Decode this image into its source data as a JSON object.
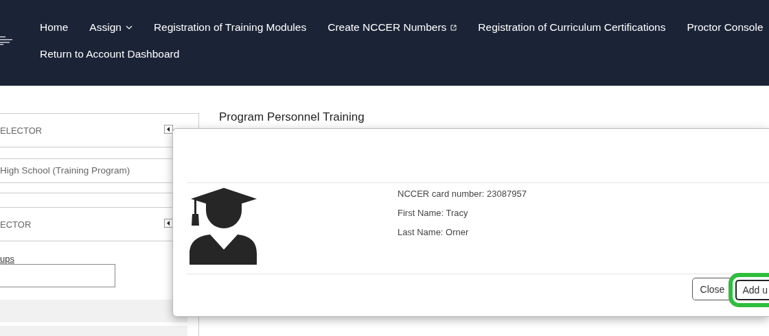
{
  "header": {
    "nav_rows": [
      [
        {
          "label": "Home",
          "kind": "link"
        },
        {
          "label": "Assign",
          "kind": "dropdown"
        },
        {
          "label": "Registration of Training Modules",
          "kind": "link"
        },
        {
          "label": "Create NCCER Numbers",
          "kind": "external"
        },
        {
          "label": "Registration of Curriculum Certifications",
          "kind": "link"
        },
        {
          "label": "Proctor Console",
          "kind": "link"
        }
      ],
      [
        {
          "label": "Return to Account Dashboard",
          "kind": "link"
        }
      ]
    ]
  },
  "sidebar": {
    "selector_1_title": "ELECTOR",
    "selected_program": "High School (Training Program)",
    "selector_2_title": "ECTOR",
    "groups_link": "ups"
  },
  "main_title": "Program Personnel Training",
  "modal": {
    "details": [
      "NCCER card number: 23087957",
      "First Name: Tracy",
      "Last Name: Orner"
    ],
    "buttons": [
      {
        "label": "Close",
        "kind": "secondary",
        "highlighted": false
      },
      {
        "label": "Add u",
        "kind": "primary",
        "highlighted": true
      }
    ]
  }
}
